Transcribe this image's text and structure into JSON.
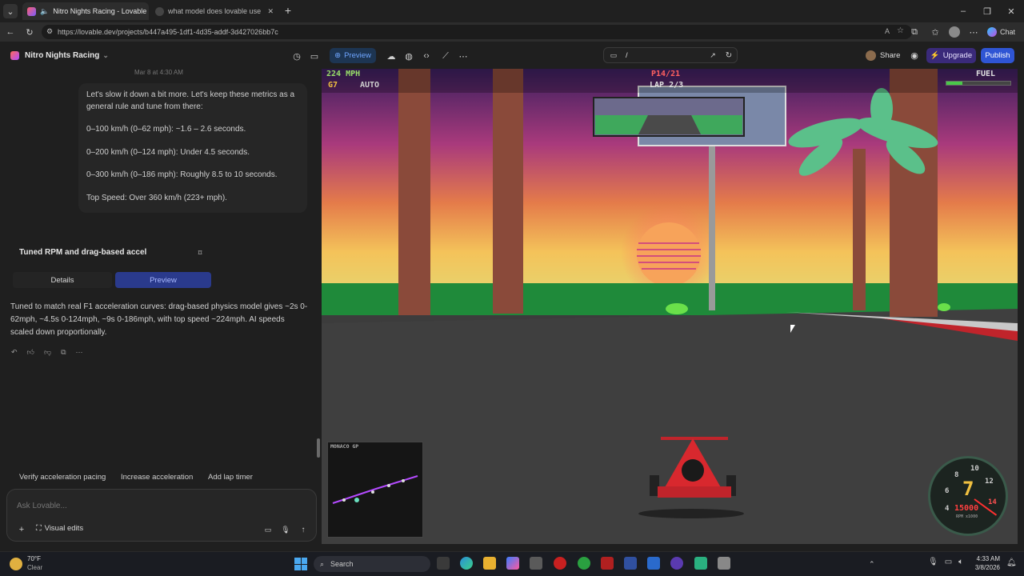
{
  "browser": {
    "tabs": [
      {
        "title": "Nitro Nights Racing - Lovable",
        "active": true
      },
      {
        "title": "what model does lovable use - Go",
        "active": false
      }
    ],
    "url": "https://lovable.dev/projects/b447a495-1df1-4d35-addf-3d427026bb7c",
    "chat_label": "Chat"
  },
  "app": {
    "project_name": "Nitro Nights Racing",
    "preview_label": "Preview",
    "path": "/",
    "share_label": "Share",
    "upgrade_label": "Upgrade",
    "publish_label": "Publish"
  },
  "chat": {
    "timestamp": "Mar 8 at 4:30 AM",
    "user_message": [
      "Let's slow it down a bit more. Let's keep these metrics as a general rule and tune from there:",
      "0–100 km/h (0–62 mph): ~1.6 – 2.6 seconds.",
      "0–200 km/h (0–124 mph): Under 4.5 seconds.",
      "0–300 km/h (0–186 mph): Roughly 8.5 to 10 seconds.",
      "Top Speed: Over 360 km/h (223+ mph)."
    ],
    "card_title": "Tuned RPM and drag-based accel",
    "details_label": "Details",
    "card_preview_label": "Preview",
    "assistant_message": "Tuned to match real F1 acceleration curves: drag-based physics model gives ~2s 0-62mph, ~4.5s 0-124mph, ~9s 0-186mph, with top speed ~224mph. AI speeds scaled down proportionally.",
    "suggestions": [
      "Verify acceleration pacing",
      "Increase acceleration",
      "Add lap timer"
    ],
    "input_placeholder": "Ask Lovable...",
    "visual_edits_label": "Visual edits"
  },
  "game": {
    "speed": "224 MPH",
    "gear": "G7",
    "mode": "AUTO",
    "position": "P14/21",
    "lap": "LAP 2/3",
    "fuel_label": "FUEL",
    "fuel_level": 0.25,
    "minimap_label": "MONACO GP",
    "gauge_gear": "7",
    "gauge_rpm": "15000",
    "gauge_unit": "RPM x1000",
    "gauge_ticks": [
      "6",
      "8",
      "10",
      "12",
      "14",
      "4"
    ]
  },
  "taskbar": {
    "temperature": "70°F",
    "condition": "Clear",
    "search_label": "Search",
    "time": "4:33 AM",
    "date": "3/8/2026"
  },
  "colors": {
    "accent_blue": "#2f55d4",
    "upgrade_purple": "#5b3fc4",
    "car_red": "#d8282e",
    "track_grass": "#1f8a3a"
  }
}
